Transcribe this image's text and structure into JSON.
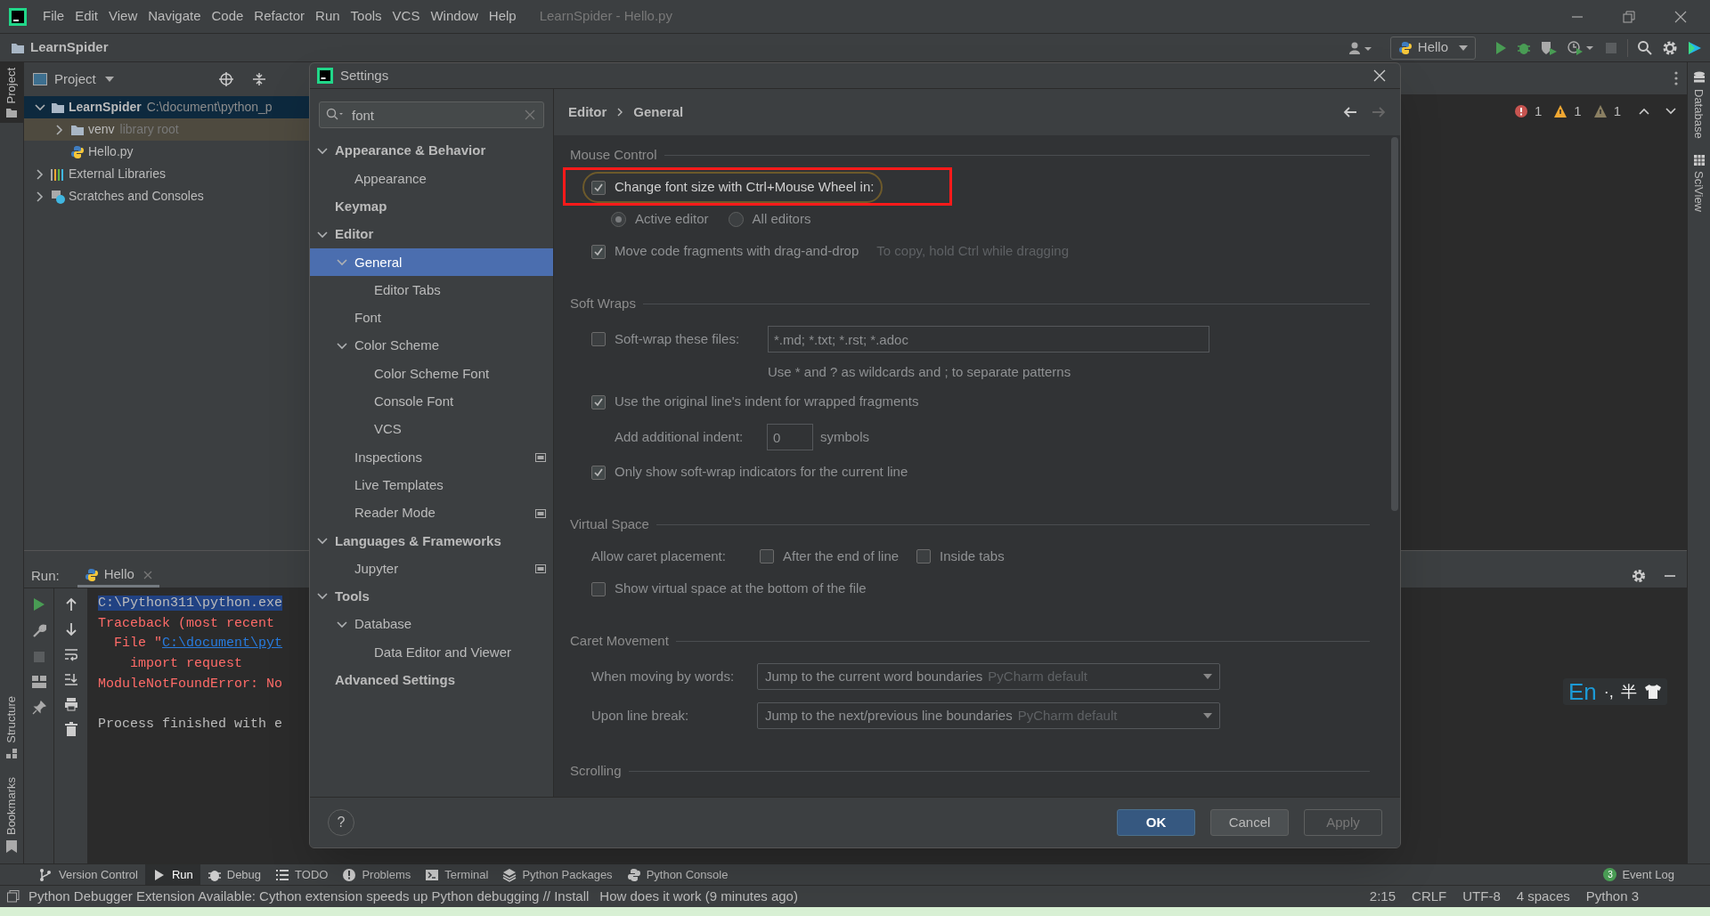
{
  "title_bar": {
    "menu": [
      "File",
      "Edit",
      "View",
      "Navigate",
      "Code",
      "Refactor",
      "Run",
      "Tools",
      "VCS",
      "Window",
      "Help"
    ],
    "title": "LearnSpider - Hello.py"
  },
  "nav_bar": {
    "project": "LearnSpider",
    "run_config": "Hello"
  },
  "left_stripe": {
    "top": [
      {
        "label": "Project",
        "selected": true
      }
    ],
    "bottom": [
      {
        "label": "Structure",
        "selected": false
      },
      {
        "label": "Bookmarks",
        "selected": false
      }
    ]
  },
  "right_stripe": [
    {
      "label": "Database",
      "kind": "database"
    },
    {
      "label": "SciView",
      "kind": "grid"
    }
  ],
  "project_panel": {
    "title": "Project",
    "tree": [
      {
        "label": "LearnSpider",
        "hint": "C:\\document\\python_p",
        "kind": "folder",
        "expanded": true,
        "selected": true,
        "children": [
          {
            "label": "venv",
            "hint": "library root",
            "kind": "library",
            "expanded": false,
            "selected": false
          },
          {
            "label": "Hello.py",
            "kind": "python",
            "selected": false
          }
        ]
      },
      {
        "label": "External Libraries",
        "kind": "libraries",
        "expanded": false,
        "selected": false
      },
      {
        "label": "Scratches and Consoles",
        "kind": "scratches",
        "expanded": false,
        "selected": false
      }
    ]
  },
  "editor": {
    "inspections": [
      {
        "kind": "error",
        "count": "1"
      },
      {
        "kind": "warning",
        "count": "1"
      },
      {
        "kind": "weak",
        "count": "1"
      }
    ]
  },
  "run_panel": {
    "label": "Run:",
    "tab": "Hello",
    "console": [
      {
        "kind": "command",
        "text": "C:\\Python311\\python.exe"
      },
      {
        "kind": "error",
        "text": "Traceback (most recent"
      },
      {
        "kind": "link",
        "text": "  File \"",
        "link": "C:\\document\\pyt"
      },
      {
        "kind": "error",
        "text": "    import request"
      },
      {
        "kind": "error",
        "text": "ModuleNotFoundError: No"
      },
      {
        "kind": "blank"
      },
      {
        "kind": "plain",
        "text": "Process finished with e"
      }
    ]
  },
  "settings": {
    "title": "Settings",
    "search": "font",
    "breadcrumb": [
      "Editor",
      "General"
    ],
    "tree": [
      {
        "label": "Appearance & Behavior",
        "expanded": true,
        "selected": false,
        "project_level": false,
        "children": [
          {
            "label": "Appearance",
            "selected": false,
            "project_level": false
          }
        ]
      },
      {
        "label": "Keymap",
        "selected": false,
        "project_level": false
      },
      {
        "label": "Editor",
        "expanded": true,
        "selected": false,
        "project_level": false,
        "children": [
          {
            "label": "General",
            "expanded": true,
            "selected": true,
            "project_level": false,
            "children": [
              {
                "label": "Editor Tabs",
                "selected": false,
                "project_level": false
              }
            ]
          },
          {
            "label": "Font",
            "selected": false,
            "project_level": false
          },
          {
            "label": "Color Scheme",
            "expanded": true,
            "selected": false,
            "project_level": false,
            "children": [
              {
                "label": "Color Scheme Font",
                "selected": false,
                "project_level": false
              },
              {
                "label": "Console Font",
                "selected": false,
                "project_level": false
              },
              {
                "label": "VCS",
                "selected": false,
                "project_level": false
              }
            ]
          },
          {
            "label": "Inspections",
            "selected": false,
            "project_level": true
          },
          {
            "label": "Live Templates",
            "selected": false,
            "project_level": false
          },
          {
            "label": "Reader Mode",
            "selected": false,
            "project_level": true
          }
        ]
      },
      {
        "label": "Languages & Frameworks",
        "expanded": true,
        "selected": false,
        "project_level": false,
        "children": [
          {
            "label": "Jupyter",
            "selected": false,
            "project_level": true
          }
        ]
      },
      {
        "label": "Tools",
        "expanded": true,
        "selected": false,
        "project_level": false,
        "children": [
          {
            "label": "Database",
            "expanded": true,
            "selected": false,
            "project_level": false,
            "children": [
              {
                "label": "Data Editor and Viewer",
                "selected": false,
                "project_level": false
              }
            ]
          }
        ]
      },
      {
        "label": "Advanced Settings",
        "selected": false,
        "project_level": false
      }
    ],
    "sections": [
      {
        "title": "Mouse Control",
        "rows": [
          {
            "kind": "checkbox",
            "label": "Change font size with Ctrl+Mouse Wheel in:",
            "checked": true,
            "focused": true
          },
          {
            "kind": "radios",
            "options": [
              {
                "label": "Active editor",
                "selected": true
              },
              {
                "label": "All editors",
                "selected": false
              }
            ]
          },
          {
            "kind": "checkbox",
            "label": "Move code fragments with drag-and-drop",
            "checked": true,
            "focused": false,
            "comment": "To copy, hold Ctrl while dragging"
          }
        ]
      },
      {
        "title": "Soft Wraps",
        "rows": [
          {
            "kind": "checkbox_field",
            "label": "Soft-wrap these files:",
            "checked": false,
            "value": "*.md; *.txt; *.rst; *.adoc"
          },
          {
            "kind": "hint",
            "text": "Use * and ? as wildcards and ; to separate patterns"
          },
          {
            "kind": "checkbox",
            "label": "Use the original line's indent for wrapped fragments",
            "checked": true,
            "focused": false
          },
          {
            "kind": "number",
            "label": "Add additional indent:",
            "value": "0",
            "unit": "symbols"
          },
          {
            "kind": "checkbox",
            "label": "Only show soft-wrap indicators for the current line",
            "checked": true,
            "focused": false
          }
        ]
      },
      {
        "title": "Virtual Space",
        "rows": [
          {
            "kind": "checks",
            "label": "Allow caret placement:",
            "options": [
              {
                "label": "After the end of line",
                "checked": false
              },
              {
                "label": "Inside tabs",
                "checked": false
              }
            ]
          },
          {
            "kind": "checkbox",
            "label": "Show virtual space at the bottom of the file",
            "checked": false,
            "focused": false
          }
        ]
      },
      {
        "title": "Caret Movement",
        "rows": [
          {
            "kind": "dropdown",
            "label": "When moving by words:",
            "value": "Jump to the current word boundaries",
            "hint": "PyCharm default"
          },
          {
            "kind": "dropdown",
            "label": "Upon line break:",
            "value": "Jump to the next/previous line boundaries",
            "hint": "PyCharm default"
          }
        ]
      },
      {
        "title": "Scrolling"
      }
    ],
    "help": "?",
    "buttons": [
      {
        "label": "OK",
        "default": true,
        "disabled": false
      },
      {
        "label": "Cancel",
        "default": false,
        "disabled": false
      },
      {
        "label": "Apply",
        "default": false,
        "disabled": true
      }
    ]
  },
  "tool_tabs": [
    {
      "label": "Version Control",
      "kind": "vcs",
      "selected": false
    },
    {
      "label": "Run",
      "kind": "run",
      "selected": true
    },
    {
      "label": "Debug",
      "kind": "debug",
      "selected": false
    },
    {
      "label": "TODO",
      "kind": "list",
      "selected": false
    },
    {
      "label": "Problems",
      "kind": "problems",
      "selected": false
    },
    {
      "label": "Terminal",
      "kind": "terminal",
      "selected": false
    },
    {
      "label": "Python Packages",
      "kind": "layers",
      "selected": false
    },
    {
      "label": "Python Console",
      "kind": "python",
      "selected": false
    }
  ],
  "event_log": {
    "count": "3",
    "label": "Event Log"
  },
  "status_bar": {
    "message": "Python Debugger Extension Available: Cython extension speeds up Python debugging // Install",
    "link": "How does it work (9 minutes ago)",
    "widgets": [
      "2:15",
      "CRLF",
      "UTF-8",
      "4 spaces",
      "Python 3"
    ]
  },
  "ime": [
    "En",
    "·,",
    "半"
  ]
}
